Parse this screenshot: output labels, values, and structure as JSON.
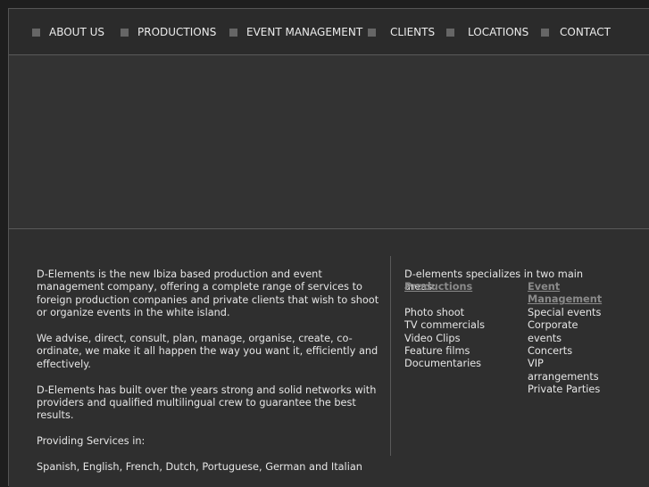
{
  "nav": {
    "items": [
      {
        "label": "ABOUT US"
      },
      {
        "label": "PRODUCTIONS"
      },
      {
        "label": "EVENT MANAGEMENT"
      },
      {
        "label": "CLIENTS"
      },
      {
        "label": "LOCATIONS"
      },
      {
        "label": "CONTACT"
      }
    ]
  },
  "about": {
    "paragraphs": [
      "D-Elements is the new Ibiza based production and event management company, offering a complete range of services to foreign production companies and private clients that wish to shoot or organize events in the white island.",
      "We advise, direct, consult, plan, manage, organise, create, co-ordinate, we make it all happen the way you want it, efficiently and effectively.",
      "D-Elements has built over the years strong and solid networks with providers and qualified multilingual crew to guarantee the best results.",
      "Providing Services in:",
      "Spanish, English, French, Dutch, Portuguese, German and Italian"
    ]
  },
  "specialties": {
    "intro": "D-elements specializes in two main areas:",
    "productions": {
      "title": "Productions",
      "items": [
        "Photo shoot",
        "TV commercials",
        "Video Clips",
        "Feature films",
        "Documentaries"
      ]
    },
    "event_management": {
      "title": "Event Management",
      "items": [
        "Special events",
        "Corporate events",
        "Concerts",
        "VIP arrangements",
        "Private Parties"
      ]
    }
  }
}
